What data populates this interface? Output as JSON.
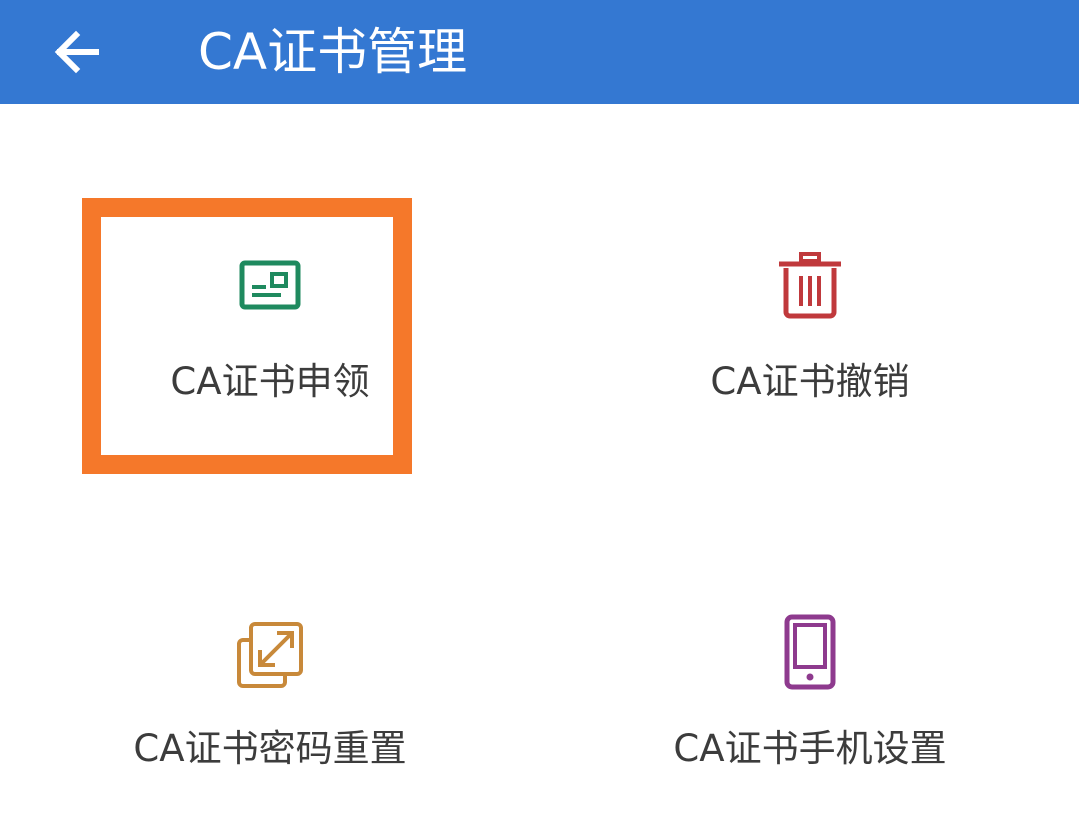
{
  "header": {
    "title": "CA证书管理",
    "back_icon": "arrow-left-icon",
    "background_color": "#3478d2"
  },
  "tiles": [
    {
      "label": "CA证书申领",
      "icon": "certificate-card-icon",
      "icon_color": "#1f8a5f"
    },
    {
      "label": "CA证书撤销",
      "icon": "trash-icon",
      "icon_color": "#c0393c"
    },
    {
      "label": "CA证书密码重置",
      "icon": "reset-arrows-icon",
      "icon_color": "#c8893a"
    },
    {
      "label": "CA证书手机设置",
      "icon": "mobile-phone-icon",
      "icon_color": "#8e3a8e"
    }
  ],
  "highlight": {
    "target": "CA证书申领",
    "color": "#f5782a"
  }
}
